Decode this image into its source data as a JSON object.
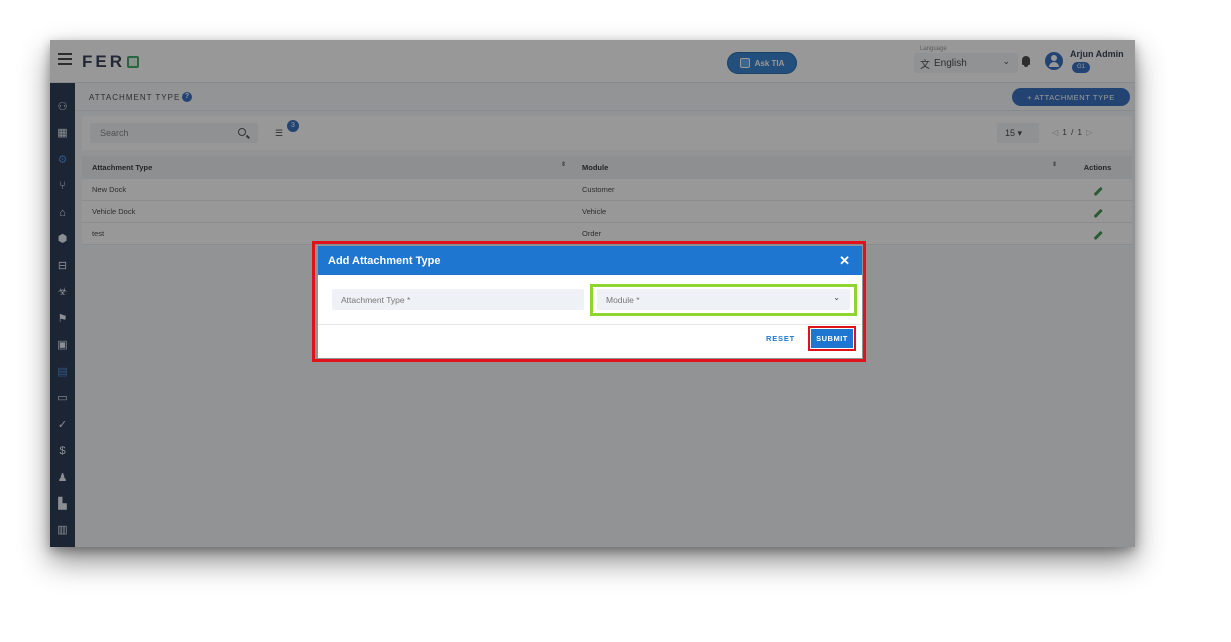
{
  "app": {
    "logo": "FER",
    "ask_label": "Ask TIA"
  },
  "header": {
    "language_label": "Language",
    "language_value": "English",
    "user_name": "Arjun Admin",
    "user_badge": "G1"
  },
  "page": {
    "title": "ATTACHMENT TYPE",
    "help": "?",
    "add_button": "+ ATTACHMENT TYPE"
  },
  "filters": {
    "search_placeholder": "Search",
    "filter_count": "3",
    "page_size": "15",
    "page_info": "1 / 1"
  },
  "table": {
    "columns": [
      "Attachment Type",
      "Module",
      "Actions"
    ],
    "rows": [
      {
        "type": "New Dock",
        "module": "Customer"
      },
      {
        "type": "Vehicle Dock",
        "module": "Vehicle"
      },
      {
        "type": "test",
        "module": "Order"
      }
    ]
  },
  "dialog": {
    "title": "Add Attachment Type",
    "attachment_type_placeholder": "Attachment Type *",
    "module_placeholder": "Module *",
    "reset_label": "RESET",
    "submit_label": "SUBMIT"
  },
  "colors": {
    "primary": "#1f76d0",
    "sidebar": "#10233f",
    "highlight_red": "#e0131c",
    "highlight_green": "#8ed52f",
    "edit_green": "#2e8b3c"
  },
  "icons": {
    "sidebar": [
      "users-icon",
      "building-icon",
      "settings-icon",
      "branch-icon",
      "warehouse-icon",
      "package-icon",
      "truck-icon",
      "biohazard-icon",
      "flag-icon",
      "id-card-icon",
      "document-icon",
      "money-icon",
      "check-icon",
      "dollar-icon",
      "user-settings-icon",
      "invoice-icon",
      "report-icon"
    ]
  }
}
